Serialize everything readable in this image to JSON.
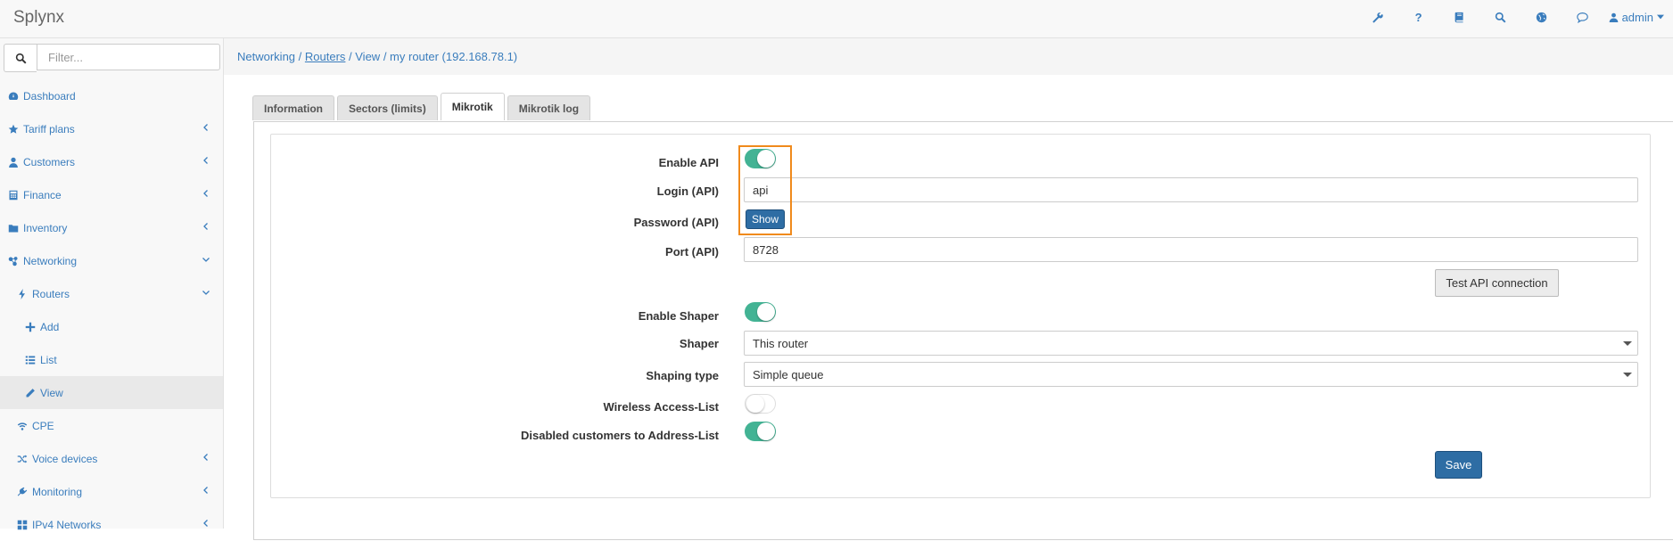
{
  "app": {
    "brand": "Splynx"
  },
  "topbar": {
    "icons": [
      "wrench-icon",
      "question-icon",
      "book-icon",
      "search-icon",
      "globe-icon",
      "chat-icon"
    ],
    "question_glyph": "?",
    "user_label": "admin"
  },
  "sidebar": {
    "filter_placeholder": "Filter...",
    "items": [
      {
        "label": "Dashboard",
        "icon": "dashboard-icon",
        "chevron": ""
      },
      {
        "label": "Tariff plans",
        "icon": "star-icon",
        "chevron": "left"
      },
      {
        "label": "Customers",
        "icon": "user-icon",
        "chevron": "left"
      },
      {
        "label": "Finance",
        "icon": "calculator-icon",
        "chevron": "left"
      },
      {
        "label": "Inventory",
        "icon": "folder-icon",
        "chevron": "left"
      },
      {
        "label": "Networking",
        "icon": "network-icon",
        "chevron": "down"
      },
      {
        "label": "Routers",
        "icon": "bolt-icon",
        "chevron": "down"
      },
      {
        "label": "Add",
        "icon": "plus-icon",
        "chevron": ""
      },
      {
        "label": "List",
        "icon": "list-icon",
        "chevron": ""
      },
      {
        "label": "View",
        "icon": "pencil-icon",
        "chevron": "",
        "active": true
      },
      {
        "label": "CPE",
        "icon": "wifi-icon",
        "chevron": ""
      },
      {
        "label": "Voice devices",
        "icon": "shuffle-icon",
        "chevron": "left"
      },
      {
        "label": "Monitoring",
        "icon": "plug-icon",
        "chevron": "left"
      },
      {
        "label": "IPv4 Networks",
        "icon": "grid-icon",
        "chevron": "left"
      }
    ]
  },
  "breadcrumb": {
    "part1": "Networking",
    "sep": " / ",
    "part2": "Routers",
    "part3": "View",
    "part4": "my router (192.168.78.1)"
  },
  "tabs": [
    {
      "label": "Information"
    },
    {
      "label": "Sectors (limits)"
    },
    {
      "label": "Mikrotik",
      "active": true
    },
    {
      "label": "Mikrotik log"
    }
  ],
  "form": {
    "enable_api_label": "Enable API",
    "enable_api": true,
    "login_label": "Login (API)",
    "login_value": "api",
    "password_label": "Password (API)",
    "show_button": "Show",
    "port_label": "Port (API)",
    "port_value": "8728",
    "test_button": "Test API connection",
    "enable_shaper_label": "Enable Shaper",
    "enable_shaper": true,
    "shaper_label": "Shaper",
    "shaper_value": "This router",
    "shaping_type_label": "Shaping type",
    "shaping_type_value": "Simple queue",
    "wireless_label": "Wireless Access-List",
    "wireless": false,
    "disabled_label": "Disabled customers to Address-List",
    "disabled": true,
    "save_button": "Save"
  },
  "colors": {
    "accent": "#3a7dbd",
    "toggle_on": "#43b394",
    "highlight": "#f08a1c",
    "primary_button": "#2e6da4"
  }
}
